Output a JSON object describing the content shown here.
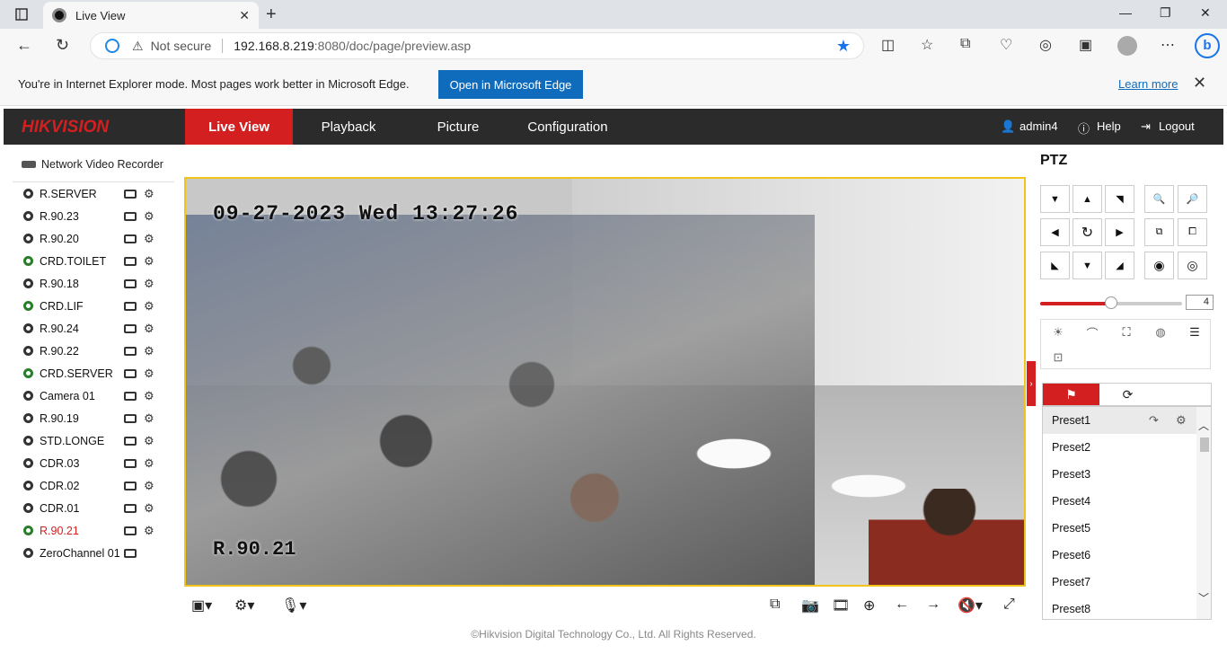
{
  "browser": {
    "tab_title": "Live View",
    "url_host": "192.168.8.219",
    "url_rest": ":8080/doc/page/preview.asp",
    "security_text": "Not secure",
    "ie_mode_message": "You're in Internet Explorer mode. Most pages work better in Microsoft Edge.",
    "open_edge_label": "Open in Microsoft Edge",
    "learn_more_label": "Learn more"
  },
  "header": {
    "logo": "HIKVISION",
    "nav": [
      "Live View",
      "Playback",
      "Picture",
      "Configuration"
    ],
    "user": "admin4",
    "help": "Help",
    "logout": "Logout"
  },
  "tree": {
    "root": "Network Video Recorder",
    "cameras": [
      {
        "label": "R.SERVER",
        "recording": false,
        "selected": false
      },
      {
        "label": "R.90.23",
        "recording": false,
        "selected": false
      },
      {
        "label": "R.90.20",
        "recording": false,
        "selected": false
      },
      {
        "label": "CRD.TOILET",
        "recording": true,
        "selected": false
      },
      {
        "label": "R.90.18",
        "recording": false,
        "selected": false
      },
      {
        "label": "CRD.LIF",
        "recording": true,
        "selected": false
      },
      {
        "label": "R.90.24",
        "recording": false,
        "selected": false
      },
      {
        "label": "R.90.22",
        "recording": false,
        "selected": false
      },
      {
        "label": "CRD.SERVER",
        "recording": true,
        "selected": false
      },
      {
        "label": "Camera 01",
        "recording": false,
        "selected": false
      },
      {
        "label": "R.90.19",
        "recording": false,
        "selected": false
      },
      {
        "label": "STD.LONGE",
        "recording": false,
        "selected": false
      },
      {
        "label": "CDR.03",
        "recording": false,
        "selected": false
      },
      {
        "label": "CDR.02",
        "recording": false,
        "selected": false
      },
      {
        "label": "CDR.01",
        "recording": false,
        "selected": false
      },
      {
        "label": "R.90.21",
        "recording": true,
        "selected": true
      },
      {
        "label": "ZeroChannel 01",
        "recording": false,
        "selected": false
      }
    ]
  },
  "video": {
    "osd_timestamp": "09-27-2023 Wed 13:27:26",
    "osd_name": "R.90.21"
  },
  "ptz": {
    "title": "PTZ",
    "speed": "4",
    "speed_level_fraction": 0.5,
    "presets": [
      "Preset1",
      "Preset2",
      "Preset3",
      "Preset4",
      "Preset5",
      "Preset6",
      "Preset7",
      "Preset8"
    ]
  },
  "footer": "©Hikvision Digital Technology Co., Ltd. All Rights Reserved.",
  "colors": {
    "brand_red": "#d31f1f",
    "header_dark": "#2b2b2b",
    "video_border": "#f0c419",
    "edge_blue": "#0f6cbd"
  }
}
